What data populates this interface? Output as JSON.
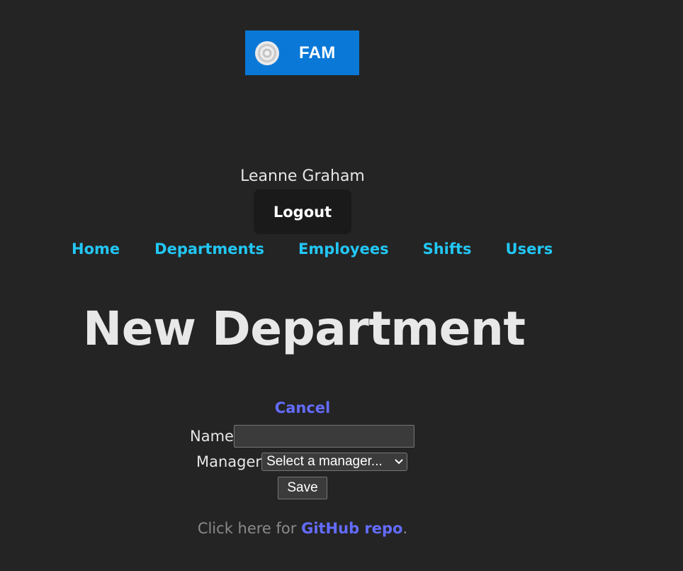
{
  "brand": {
    "logo_icon": "target-icon",
    "name": "FAM",
    "color": "#0a78d7"
  },
  "user": {
    "name": "Leanne Graham",
    "logout_label": "Logout"
  },
  "nav": {
    "items": [
      {
        "label": "Home"
      },
      {
        "label": "Departments"
      },
      {
        "label": "Employees"
      },
      {
        "label": "Shifts"
      },
      {
        "label": "Users"
      }
    ],
    "color": "#22c7f5"
  },
  "page": {
    "title": "New Department"
  },
  "form": {
    "cancel_label": "Cancel",
    "name_label": "Name",
    "name_value": "",
    "manager_label": "Manager",
    "manager_selected": "Select a manager...",
    "save_label": "Save"
  },
  "footer": {
    "prefix": "Click here for ",
    "link_text": "GitHub repo",
    "suffix": ".",
    "link_color": "#646cff"
  }
}
